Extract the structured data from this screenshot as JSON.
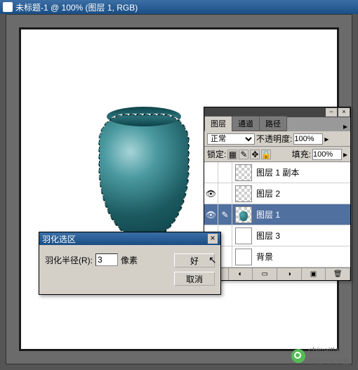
{
  "window": {
    "title": "未标题-1 @ 100% (图层 1, RGB)"
  },
  "panel": {
    "tabs": [
      "图层",
      "通道",
      "路径"
    ],
    "blend_mode": "正常",
    "opacity_label": "不透明度:",
    "opacity_value": "100%",
    "lock_label": "锁定:",
    "fill_label": "填充:",
    "fill_value": "100%",
    "layers": [
      {
        "name": "图层 1 副本",
        "visible": false,
        "thumb": "checker"
      },
      {
        "name": "图层 2",
        "visible": true,
        "thumb": "checker"
      },
      {
        "name": "图层 1",
        "visible": true,
        "thumb": "vase",
        "selected": true
      },
      {
        "name": "图层 3",
        "visible": true,
        "thumb": "plain"
      },
      {
        "name": "背景",
        "visible": true,
        "thumb": "white"
      }
    ]
  },
  "dialog": {
    "title": "羽化选区",
    "radius_label": "羽化半径(R):",
    "radius_value": "3",
    "unit": "像素",
    "ok": "好",
    "cancel": "取消"
  },
  "watermark": {
    "main": "chinaitlab",
    "sub": "中国IT实验室"
  }
}
